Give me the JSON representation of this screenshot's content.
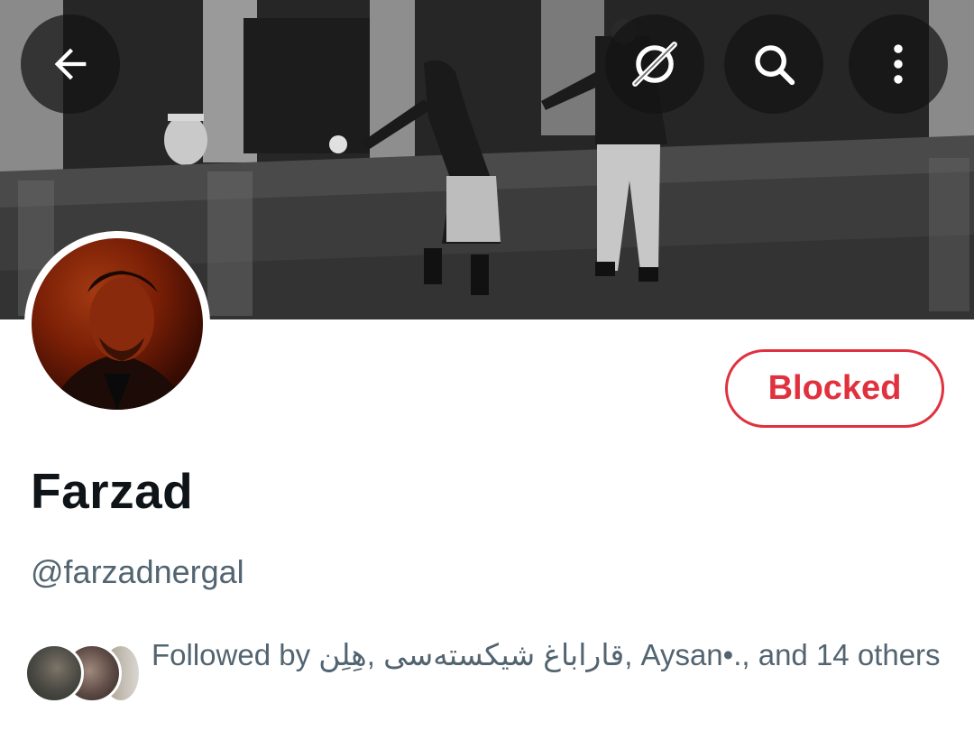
{
  "header": {
    "back_icon": "arrow-left-icon",
    "grok_icon": "grok-icon",
    "search_icon": "search-icon",
    "more_icon": "more-vertical-icon"
  },
  "profile": {
    "display_name": "Farzad",
    "handle": "@farzadnergal",
    "action_button_label": "Blocked",
    "action_button_color": "#e0313e"
  },
  "followed_by": {
    "prefix": "Followed by",
    "name_1": "هِلِن",
    "separator_1": ",",
    "name_2": "قاراباغ شیکسته‌سی",
    "separator_2": ",",
    "name_3": "Aysan•.",
    "suffix": ", and 14 others"
  },
  "colors": {
    "text_primary": "#0f1419",
    "text_secondary": "#536471",
    "danger": "#e0313e"
  }
}
